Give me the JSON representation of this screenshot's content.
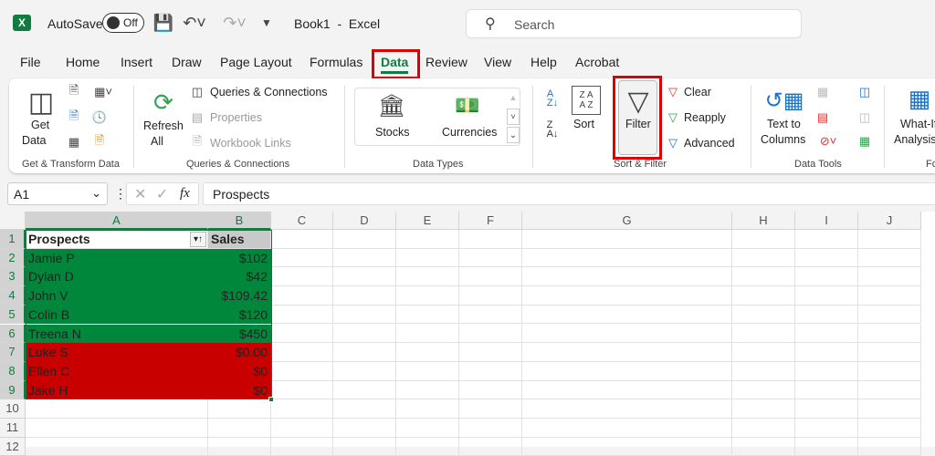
{
  "titlebar": {
    "autosave_label": "AutoSave",
    "autosave_state": "Off",
    "title": "Book1  -  Excel",
    "search_placeholder": "Search"
  },
  "menu": [
    "File",
    "Home",
    "Insert",
    "Draw",
    "Page Layout",
    "Formulas",
    "Data",
    "Review",
    "View",
    "Help",
    "Acrobat"
  ],
  "active_tab": "Data",
  "ribbon": {
    "get_transform": {
      "get_data_line1": "Get",
      "get_data_line2": "Data",
      "group": "Get & Transform Data"
    },
    "queries": {
      "refresh_line1": "Refresh",
      "refresh_line2": "All",
      "queries_connections": "Queries & Connections",
      "properties": "Properties",
      "workbook_links": "Workbook Links",
      "group": "Queries & Connections"
    },
    "data_types": {
      "stocks": "Stocks",
      "currencies": "Currencies",
      "group": "Data Types"
    },
    "sort_filter": {
      "sort": "Sort",
      "filter": "Filter",
      "clear": "Clear",
      "reapply": "Reapply",
      "advanced": "Advanced",
      "group": "Sort & Filter"
    },
    "data_tools": {
      "text_to_columns_line1": "Text to",
      "text_to_columns_line2": "Columns",
      "group": "Data Tools"
    },
    "forecast": {
      "what_if_line1": "What-If",
      "what_if_line2": "Analysis",
      "group": "Fo"
    }
  },
  "formula_bar": {
    "name_box": "A1",
    "fx": "fx",
    "content": "Prospects"
  },
  "columns": [
    "A",
    "B",
    "C",
    "D",
    "E",
    "F",
    "G",
    "H",
    "I",
    "J"
  ],
  "rows": [
    "1",
    "2",
    "3",
    "4",
    "5",
    "6",
    "7",
    "8",
    "9",
    "10",
    "11",
    "12"
  ],
  "table": {
    "headers": [
      "Prospects",
      "Sales"
    ],
    "data": [
      [
        "Jamie P",
        "$102"
      ],
      [
        "Dylan D",
        "$42"
      ],
      [
        "John V",
        "$109.42"
      ],
      [
        "Colin B",
        "$120"
      ],
      [
        "Treena N",
        "$450"
      ],
      [
        "Luke S",
        "$0.00"
      ],
      [
        "Ellen C",
        "$0"
      ],
      [
        "Jake H",
        "$0"
      ]
    ]
  },
  "colors": {
    "green_fill": "#00873b",
    "red_fill": "#c80000",
    "highlight": "#e00000",
    "excel_green": "#107c41"
  }
}
